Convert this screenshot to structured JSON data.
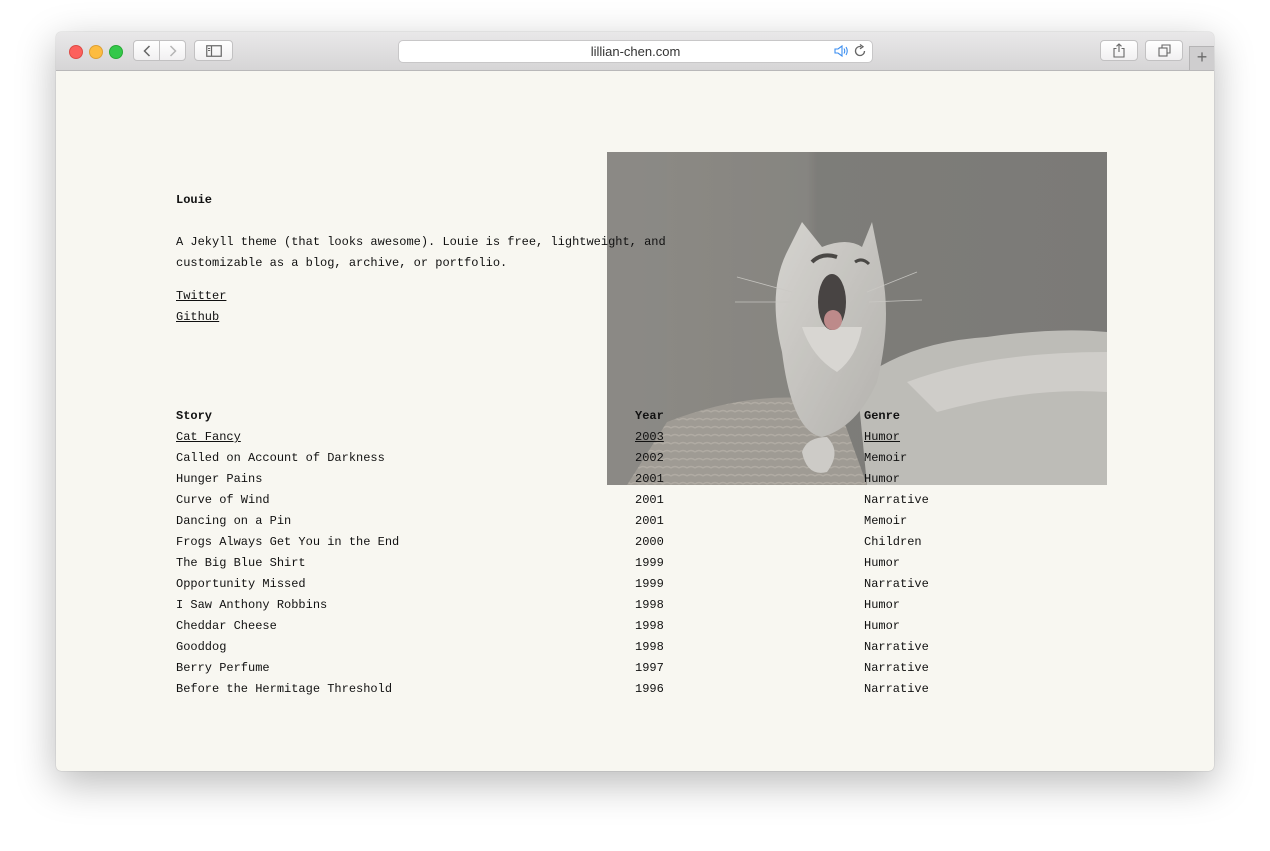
{
  "browser": {
    "url": "lillian-chen.com"
  },
  "site": {
    "title": "Louie",
    "tagline_line1": "A Jekyll theme (that looks awesome). Louie is free, lightweight, and",
    "tagline_line2": "customizable as a blog, archive, or portfolio.",
    "links": [
      "Twitter",
      "Github"
    ]
  },
  "table": {
    "headers": [
      "Story",
      "Year",
      "Genre"
    ],
    "rows": [
      [
        "Cat Fancy",
        "2003",
        "Humor"
      ],
      [
        "Called on Account of Darkness",
        "2002",
        "Memoir"
      ],
      [
        "Hunger Pains",
        "2001",
        "Humor"
      ],
      [
        "Curve of Wind",
        "2001",
        "Narrative"
      ],
      [
        "Dancing on a Pin",
        "2001",
        "Memoir"
      ],
      [
        "Frogs Always Get You in the End",
        "2000",
        "Children"
      ],
      [
        "The Big Blue Shirt",
        "1999",
        "Humor"
      ],
      [
        "Opportunity Missed",
        "1999",
        "Narrative"
      ],
      [
        "I Saw Anthony Robbins",
        "1998",
        "Humor"
      ],
      [
        "Cheddar Cheese",
        "1998",
        "Humor"
      ],
      [
        "Gooddog",
        "1998",
        "Narrative"
      ],
      [
        "Berry Perfume",
        "1997",
        "Narrative"
      ],
      [
        "Before the Hermitage Threshold",
        "1996",
        "Narrative"
      ]
    ]
  },
  "colors": {
    "page_background": "#f8f7f1",
    "text": "#111111"
  },
  "icons": [
    "back-arrow-icon",
    "forward-arrow-icon",
    "sidebar-icon",
    "audio-icon",
    "reload-icon",
    "share-icon",
    "tabs-icon",
    "plus-icon"
  ]
}
